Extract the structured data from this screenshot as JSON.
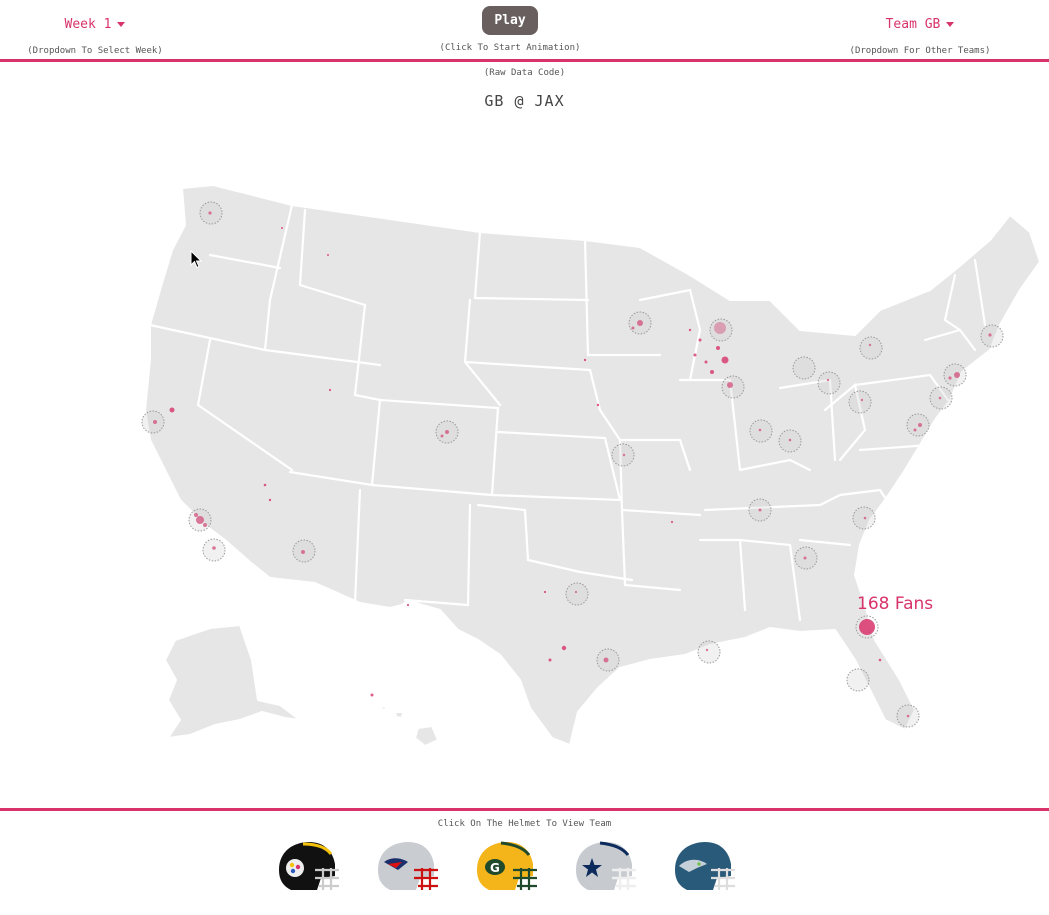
{
  "controls": {
    "week_label": "Week 1",
    "week_hint": "(Dropdown To Select Week)",
    "play_label": "Play",
    "play_hint": "(Click To Start Animation)",
    "team_label": "Team GB",
    "team_hint": "(Dropdown For Other Teams)"
  },
  "raw_data_link": "(Raw Data Code)",
  "matchup": "GB @ JAX",
  "highlight": {
    "text": "168 Fans",
    "color": "#d8336b"
  },
  "footer_hint": "Click On The Helmet To View Team",
  "helmets": [
    {
      "team": "PIT",
      "icon": "steelers-helmet-icon"
    },
    {
      "team": "NE",
      "icon": "patriots-helmet-icon"
    },
    {
      "team": "GB",
      "icon": "packers-helmet-icon"
    },
    {
      "team": "DAL",
      "icon": "cowboys-helmet-icon"
    },
    {
      "team": "SEA",
      "icon": "seahawks-helmet-icon"
    }
  ],
  "colors": {
    "accent": "#d8336b",
    "land": "#e6e6e6",
    "play_button": "#6a5f5f"
  }
}
